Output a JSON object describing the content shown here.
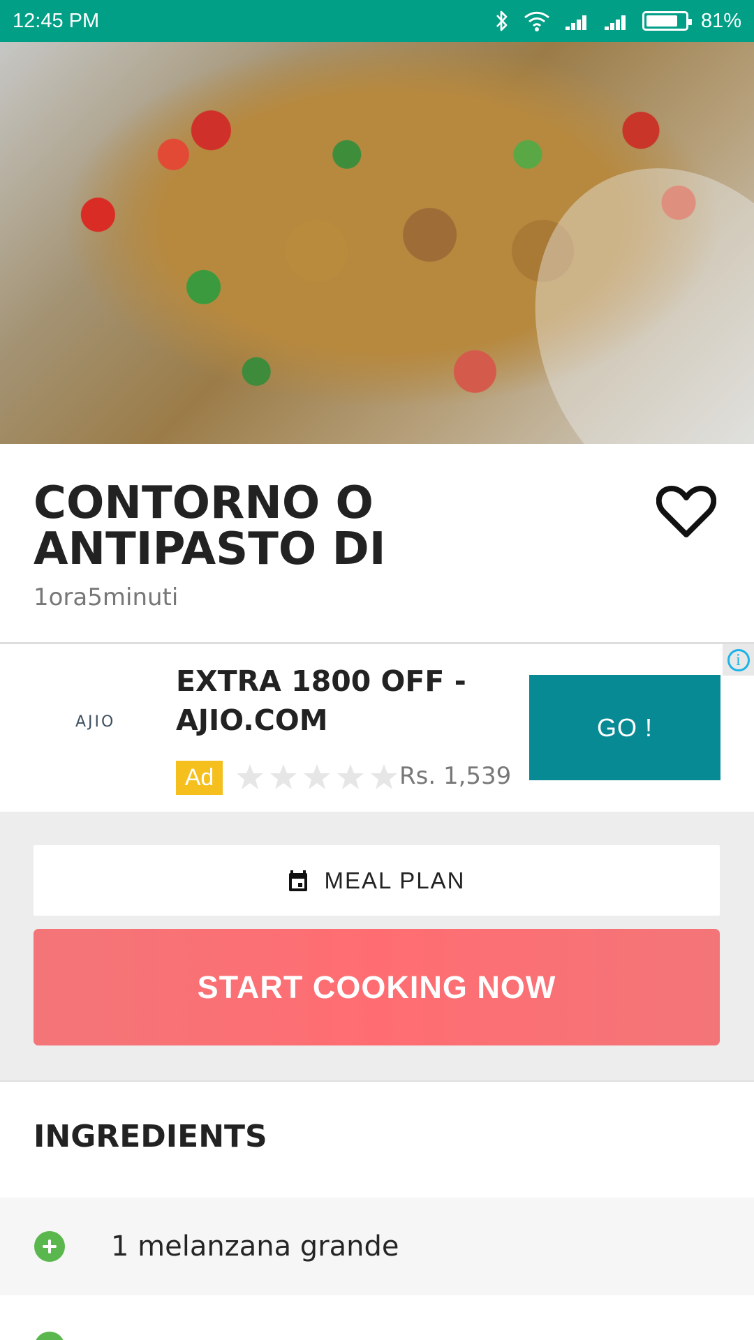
{
  "status_bar": {
    "time": "12:45 PM",
    "battery": "81%",
    "battery_level": 0.81,
    "icons": [
      "bluetooth-icon",
      "wifi-icon",
      "signal-icon",
      "signal-icon",
      "battery-icon"
    ]
  },
  "recipe": {
    "title_line_1": "CONTORNO O",
    "title_line_2": "ANTIPASTO DI",
    "time": "1ora5minuti",
    "favorite_icon": "heart-outline-icon"
  },
  "ad": {
    "brand": "AJIO",
    "headline_line_1": "EXTRA 1800 OFF -",
    "headline_line_2": "AJIO.COM",
    "badge": "Ad",
    "rating": 0,
    "rating_max": 5,
    "price": "Rs. 1,539",
    "button": "GO !",
    "info_icon": "info-icon",
    "colors": {
      "button": "#088a95",
      "badge": "#f5bf1e",
      "info": "#1cb3e6"
    }
  },
  "actions": {
    "meal_plan": "MEAL PLAN",
    "calendar_icon": "calendar-icon",
    "start_cooking": "START COOKING NOW",
    "colors": {
      "start_cooking": "#ff6d72"
    }
  },
  "ingredients": {
    "title": "INGREDIENTS",
    "items": [
      {
        "text": "1 melanzana grande",
        "icon": "add-circle-icon"
      },
      {
        "text": "",
        "icon": "add-circle-icon"
      }
    ]
  },
  "colors": {
    "status_bar": "#009f86",
    "accent_green": "#5ab74d",
    "primary_text": "#222222"
  }
}
